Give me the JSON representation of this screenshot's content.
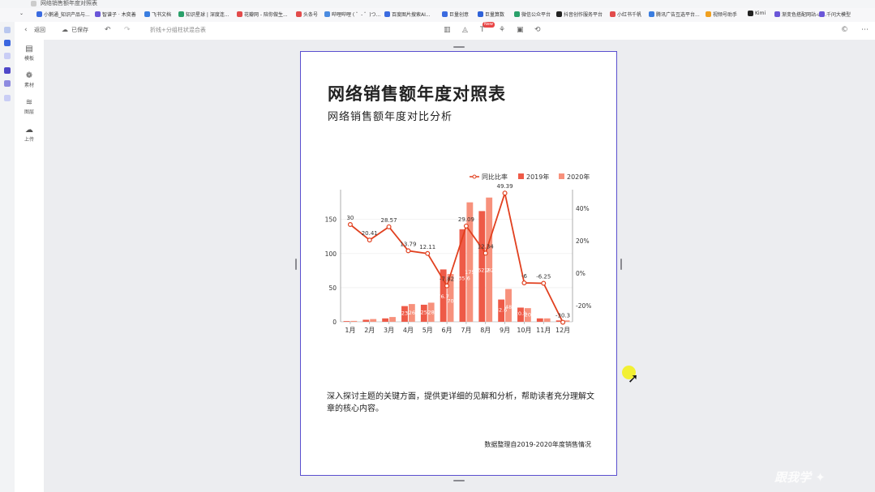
{
  "browser": {
    "tab_title": "网络销售额年度对照表",
    "bookmarks": [
      "小鹅通_知识产品与...",
      "智谱子 · 木奕善",
      "飞书文档",
      "知识星球 | 深度连...",
      "花瓣网 - 陪你做生...",
      "头条号",
      "哔哩哔哩 ( ゜- ゜)つ...",
      "百度图片搜索AI...",
      "巨量创意",
      "巨量算数",
      "微信公众平台",
      "抖音创作服务平台",
      "小红书千帆",
      "腾讯广告互选平台...",
      "视频号助手",
      "Kimi",
      "渐变色搭配网站-ui...",
      "千问大模型"
    ]
  },
  "toolbar": {
    "back_label": "返回",
    "saved_label": "已保存",
    "chart_type_label": "折线+分组柱状混合表",
    "new_badge": "New"
  },
  "left_panel": {
    "tools": [
      {
        "label": "模板",
        "icon": "template-icon"
      },
      {
        "label": "素材",
        "icon": "material-icon"
      },
      {
        "label": "图层",
        "icon": "layers-icon"
      },
      {
        "label": "上传",
        "icon": "upload-icon"
      }
    ]
  },
  "page": {
    "title": "网络销售额年度对照表",
    "subtitle": "网络销售额年度对比分析",
    "body": "深入探讨主题的关键方面，提供更详细的见解和分析，帮助读者充分理解文章的核心内容。",
    "footer": "数据整理自2019-2020年度销售情况"
  },
  "chart_data": {
    "type": "bar",
    "categories": [
      "1月",
      "2月",
      "3月",
      "4月",
      "5月",
      "6月",
      "7月",
      "8月",
      "9月",
      "10月",
      "11月",
      "12月"
    ],
    "series": [
      {
        "name": "2019年",
        "type": "bar",
        "color": "#ee5a47",
        "values": [
          1,
          3,
          5,
          23,
          25,
          76.7,
          135.6,
          162.2,
          32.6,
          20.8,
          5,
          2
        ]
      },
      {
        "name": "2020年",
        "type": "bar",
        "color": "#f7917c",
        "values": [
          1.3,
          4,
          7,
          26,
          28,
          70,
          175,
          182,
          48,
          20,
          5,
          2
        ]
      },
      {
        "name": "同比比率",
        "type": "line",
        "axis": "right",
        "color": "#e1401f",
        "values": [
          30,
          20.41,
          28.57,
          13.79,
          12.11,
          -7.82,
          29.09,
          12.34,
          49.39,
          -6,
          -6.25,
          -30.3
        ]
      },
      {
        "name": "",
        "type": "data-labels",
        "values": [
          "30",
          "20.41",
          "28.57",
          "13.79",
          "12.11",
          "-7.82",
          "29.09",
          "12.34",
          "49.39",
          "-6",
          "-6.25",
          "-30.3"
        ]
      }
    ],
    "bar_labels_2019": [
      "1",
      "3",
      "5",
      "23",
      "25",
      "76.7",
      "135.6",
      "162.2",
      "32.6",
      "20.8",
      "5",
      "2"
    ],
    "bar_labels_2020": [
      "1.3",
      "4",
      "7",
      "26",
      "28",
      "70",
      "175",
      "182",
      "48",
      "20",
      "5",
      "2"
    ],
    "y_left": {
      "ticks": [
        0,
        50,
        100,
        150
      ],
      "lim": [
        0,
        190
      ]
    },
    "y_right": {
      "ticks": [
        "-20%",
        "0%",
        "20%",
        "40%"
      ],
      "lim": [
        -30,
        50
      ]
    },
    "legend": {
      "position": "top-right",
      "items": [
        "同比比率",
        "2019年",
        "2020年"
      ]
    },
    "grid": true
  }
}
